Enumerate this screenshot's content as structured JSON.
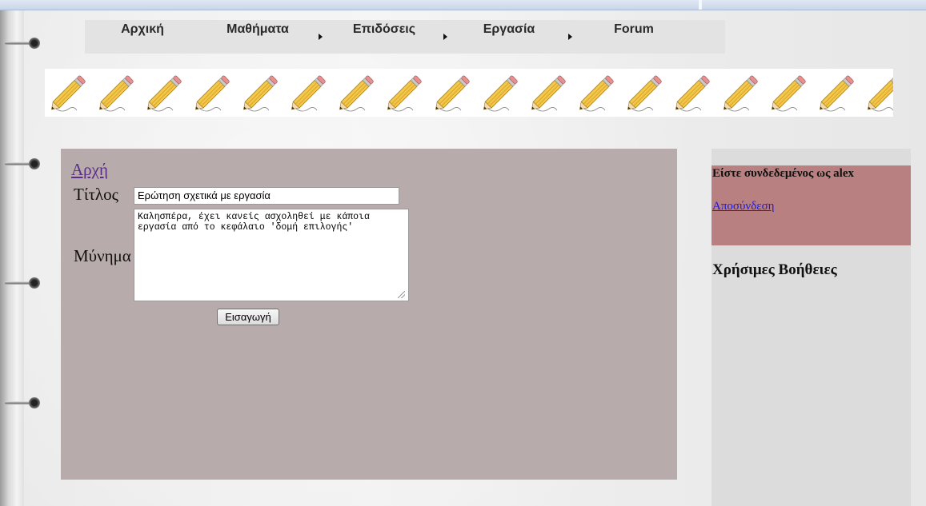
{
  "nav": {
    "items": [
      {
        "label": "Αρχική",
        "has_submenu": false
      },
      {
        "label": "Μαθήματα",
        "has_submenu": true
      },
      {
        "label": "Επιδόσεις",
        "has_submenu": true
      },
      {
        "label": "Εργασία",
        "has_submenu": true
      },
      {
        "label": "Forum",
        "has_submenu": false
      }
    ]
  },
  "banner": {
    "icon": "pencil-icon",
    "count": 18
  },
  "main": {
    "home_link": "Αρχή",
    "title_label": "Τίτλος",
    "title_value": "Ερώτηση σχετικά με εργασία",
    "message_label": "Μύνημα",
    "message_value": "Καλησπέρα, έχει κανείς ασχοληθεί με κάποια εργασία από το κεφάλαιο 'δομή επιλογής'",
    "submit_label": "Εισαγωγή"
  },
  "sidebar": {
    "login_text": "Είστε συνδεδεμένος ως alex",
    "logout_label": "Αποσύνδεση",
    "help_title": "Χρήσιμες Βοήθειες"
  },
  "colors": {
    "main_panel": "#b8abab",
    "sidebar": "#dcdcdc",
    "login_box": "#b88080",
    "link_visited": "#5a2d86",
    "link": "#1a1ae0"
  }
}
